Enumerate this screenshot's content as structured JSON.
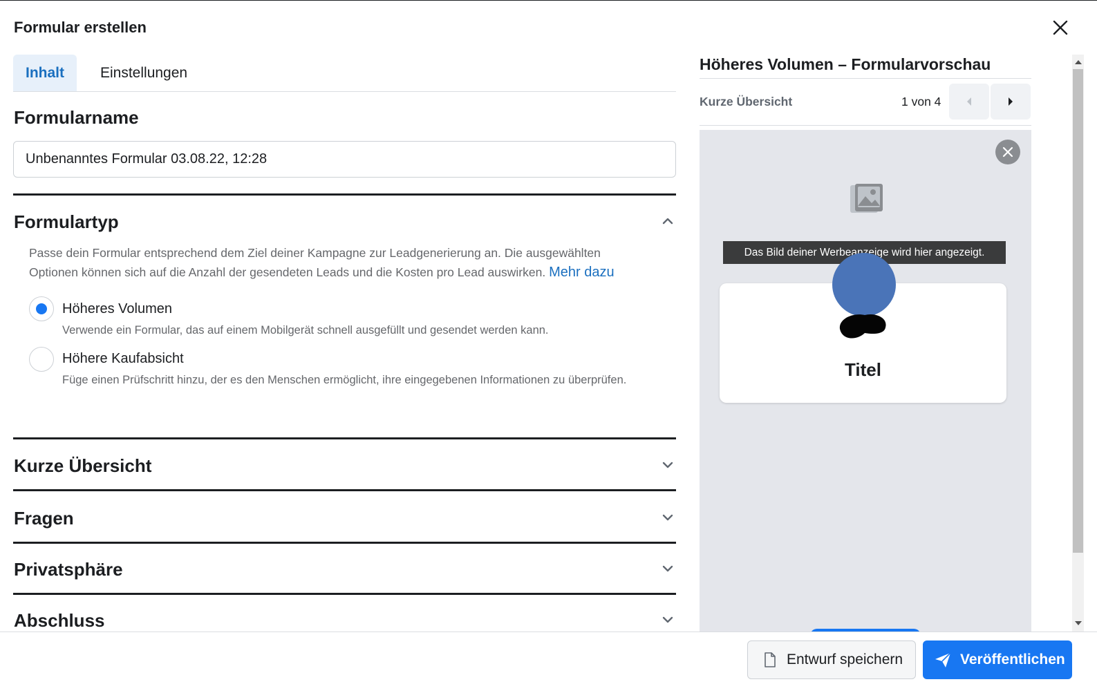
{
  "modal": {
    "title": "Formular erstellen"
  },
  "tabs": [
    {
      "label": "Inhalt",
      "active": true
    },
    {
      "label": "Einstellungen",
      "active": false
    }
  ],
  "form_name": {
    "heading": "Formularname",
    "value": "Unbenanntes Formular 03.08.22, 12:28"
  },
  "form_type": {
    "heading": "Formulartyp",
    "description": "Passe dein Formular entsprechend dem Ziel deiner Kampagne zur Leadgenerierung an. Die ausgewählten Optionen können sich auf die Anzahl der gesendeten Leads und die Kosten pro Lead auswirken.",
    "learn_more": "Mehr dazu",
    "options": [
      {
        "label": "Höheres Volumen",
        "sub": "Verwende ein Formular, das auf einem Mobilgerät schnell ausgefüllt und gesendet werden kann.",
        "checked": true
      },
      {
        "label": "Höhere Kaufabsicht",
        "sub": "Füge einen Prüfschritt hinzu, der es den Menschen ermöglicht, ihre eingegebenen Informationen zu überprüfen.",
        "checked": false
      }
    ]
  },
  "sections": [
    {
      "label": "Kurze Übersicht"
    },
    {
      "label": "Fragen"
    },
    {
      "label": "Privatsphäre"
    },
    {
      "label": "Abschluss"
    }
  ],
  "preview": {
    "title": "Höheres Volumen – Formularvorschau",
    "step_label": "Kurze Übersicht",
    "page_counter": "1 von 4",
    "image_tooltip": "Das Bild deiner Werbeanzeige wird hier angezeigt.",
    "card_title": "Titel"
  },
  "footer": {
    "draft_label": "Entwurf speichern",
    "publish_label": "Veröffentlichen"
  },
  "colors": {
    "accent": "#1877f2",
    "link": "#1a6fbf",
    "tab_active_bg": "#e7f0fa",
    "avatar": "#4a74b8"
  },
  "icons": {
    "close": "close-icon",
    "chevron_up": "chevron-up-icon",
    "chevron_down": "chevron-down-icon",
    "prev": "caret-left-icon",
    "next": "caret-right-icon",
    "image": "image-icon",
    "draft": "document-icon",
    "publish": "paper-plane-icon"
  }
}
